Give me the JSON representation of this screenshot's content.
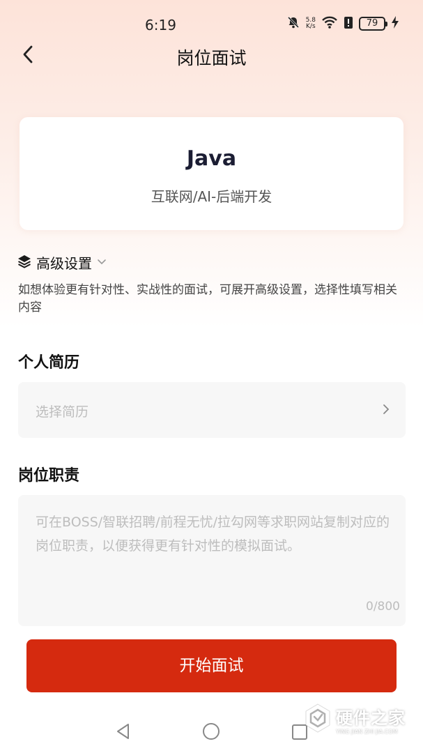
{
  "status_bar": {
    "time": "6:19",
    "net_speed_value": "5.8",
    "net_speed_unit": "K/s",
    "battery": "79",
    "icons": [
      "bell-off-icon",
      "wifi-icon",
      "battery-saver-icon",
      "charging-icon"
    ]
  },
  "header": {
    "title": "岗位面试",
    "back_icon": "chevron-left-icon"
  },
  "job": {
    "title": "Java",
    "category": "互联网/AI-后端开发"
  },
  "advanced": {
    "label": "高级设置",
    "icon": "layers-icon",
    "description": "如想体验更有针对性、实战性的面试，可展开高级设置，选择性填写相关内容"
  },
  "resume": {
    "title": "个人简历",
    "placeholder": "选择简历"
  },
  "duty": {
    "title": "岗位职责",
    "placeholder": "可在BOSS/智联招聘/前程无忧/拉勾网等求职网站复制对应的岗位职责，以便获得更有针对性的模拟面试。",
    "counter": "0/800"
  },
  "actions": {
    "start_label": "开始面试"
  },
  "watermark": {
    "main": "硬件之家",
    "sub": "YING JIAN ZHI JIA.COM"
  },
  "colors": {
    "accent": "#d52a0f",
    "header_gradient_top": "#fde3d9",
    "field_bg": "#f7f7f7"
  }
}
